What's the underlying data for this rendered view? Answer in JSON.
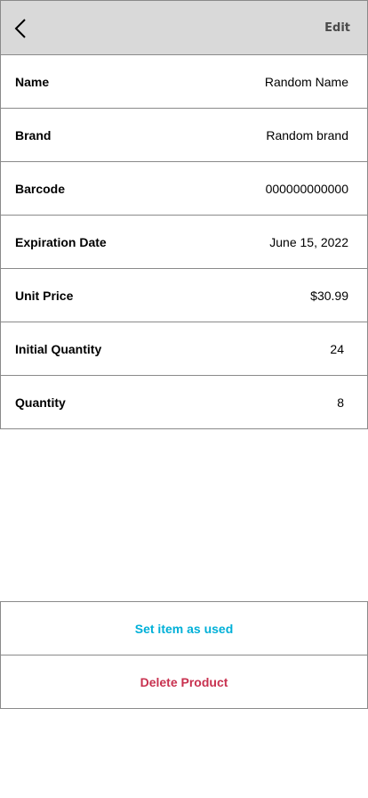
{
  "header": {
    "back_icon": "chevron-left-icon",
    "edit_label": "Edit"
  },
  "details": [
    {
      "label": "Name",
      "value": "Random Name"
    },
    {
      "label": "Brand",
      "value": "Random brand"
    },
    {
      "label": "Barcode",
      "value": "000000000000"
    },
    {
      "label": "Expiration Date",
      "value": "June 15, 2022"
    },
    {
      "label": "Unit Price",
      "value": "$30.99"
    },
    {
      "label": "Initial Quantity",
      "value": "24"
    },
    {
      "label": "Quantity",
      "value": "8"
    }
  ],
  "actions": {
    "set_used_label": "Set item as used",
    "set_used_color": "#00b0d8",
    "delete_label": "Delete Product",
    "delete_color": "#c8314f"
  },
  "colors": {
    "header_bg": "#d9d9d9",
    "border": "#8a8a8a",
    "edit_text": "#4a4a4a"
  }
}
